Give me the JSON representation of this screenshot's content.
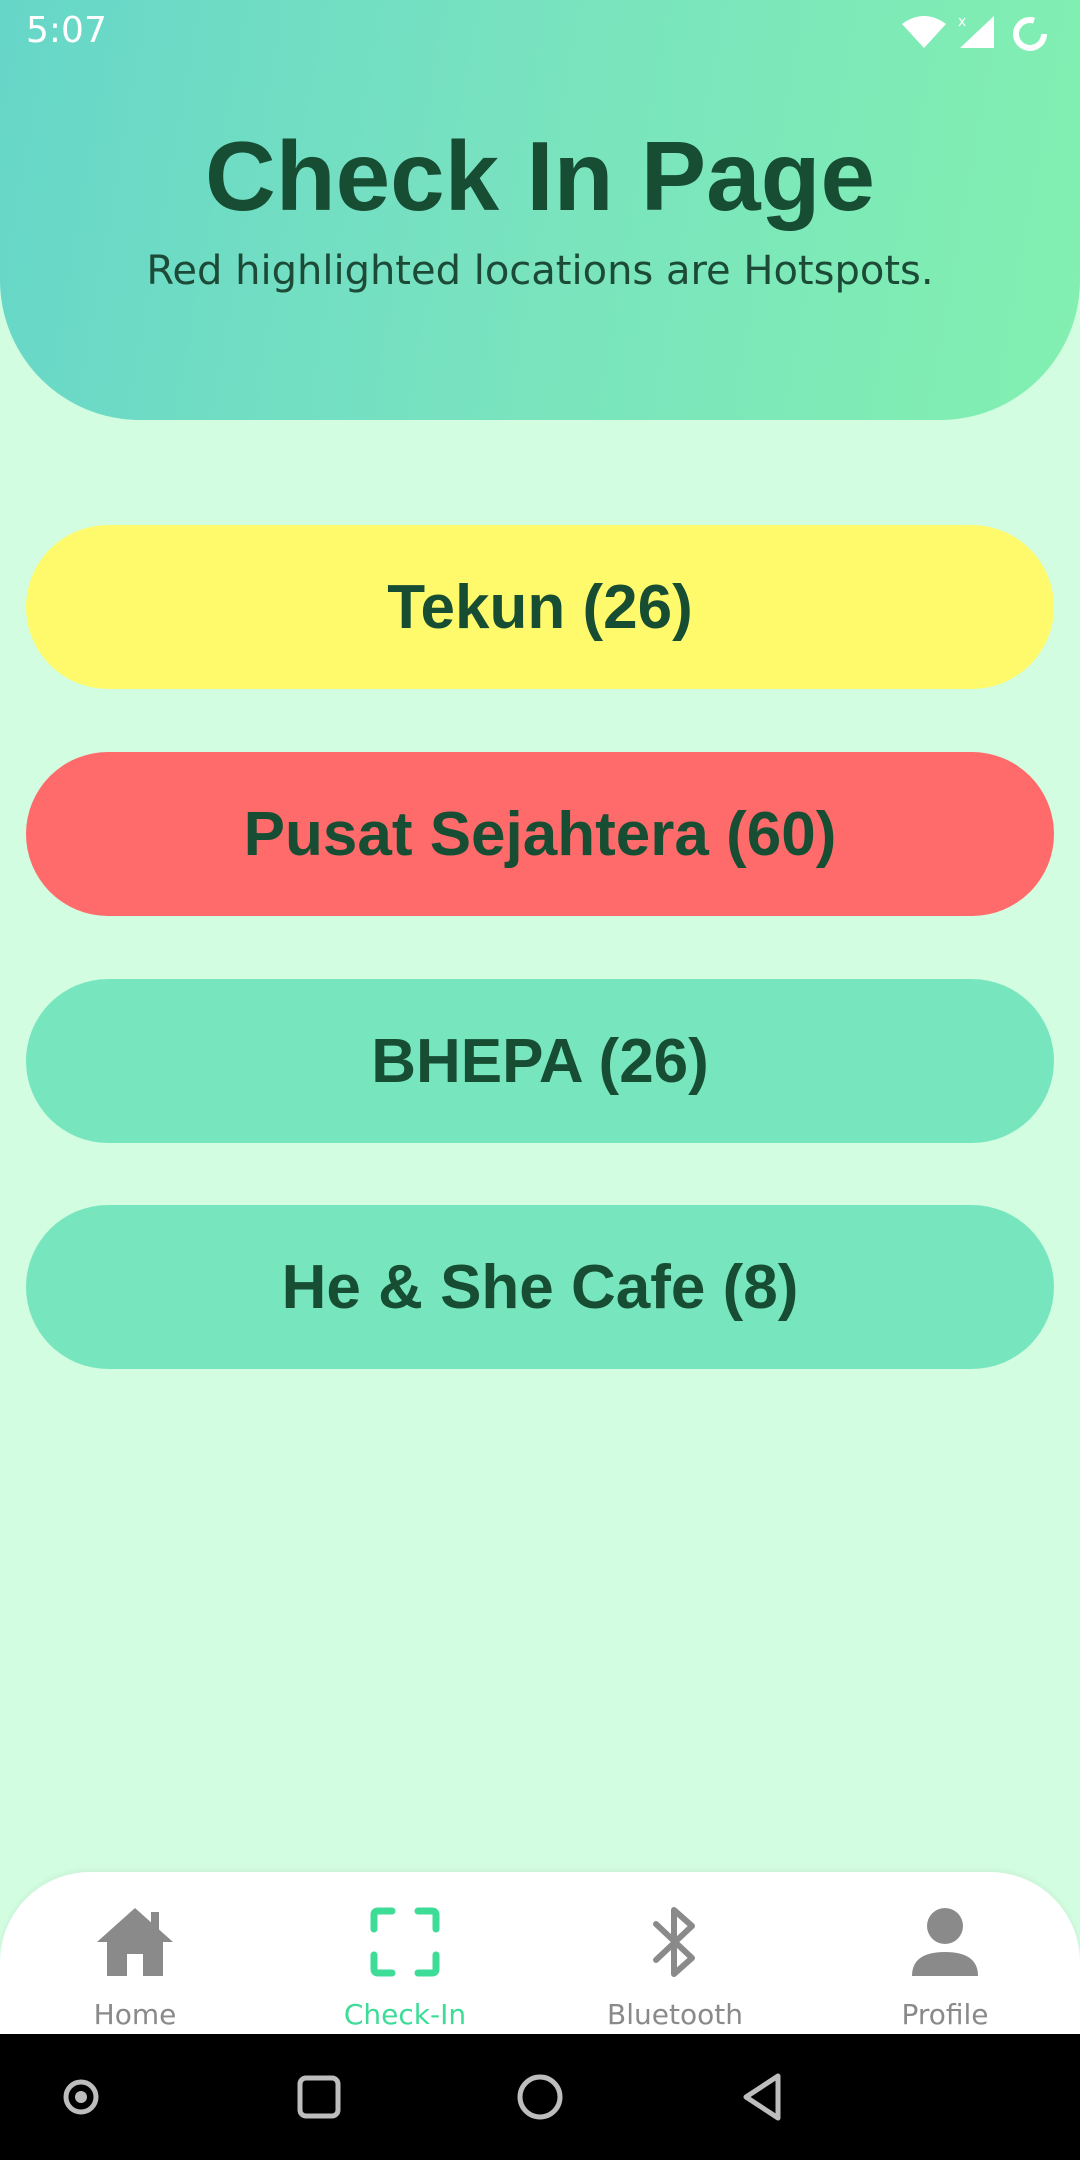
{
  "status_bar": {
    "time": "5:07"
  },
  "header": {
    "title": "Check In Page",
    "subtitle": "Red highlighted locations are Hotspots."
  },
  "locations": [
    {
      "label": "Tekun (26)",
      "color": "#fffa6b"
    },
    {
      "label": "Pusat Sejahtera (60)",
      "color": "#ff6b6b"
    },
    {
      "label": "BHEPA (26)",
      "color": "#77e6bf"
    },
    {
      "label": "He & She Cafe (8)",
      "color": "#77e6bf"
    }
  ],
  "bottom_nav": {
    "items": [
      {
        "label": "Home",
        "icon": "home-icon"
      },
      {
        "label": "Check-In",
        "icon": "scan-frame-icon",
        "active": true
      },
      {
        "label": "Bluetooth",
        "icon": "bluetooth-icon"
      },
      {
        "label": "Profile",
        "icon": "person-icon"
      }
    ],
    "active_color": "#3ddc97",
    "inactive_color": "#8a8a8a"
  },
  "system_nav": {
    "icons": [
      "dot-icon",
      "recents-icon",
      "home-circle-icon",
      "back-icon"
    ]
  }
}
